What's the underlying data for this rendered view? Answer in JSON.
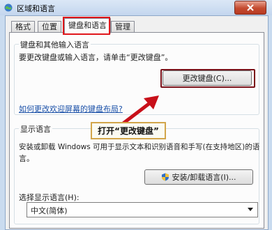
{
  "window": {
    "title": "区域和语言"
  },
  "tabs": [
    {
      "label": "格式"
    },
    {
      "label": "位置"
    },
    {
      "label": "键盘和语言"
    },
    {
      "label": "管理"
    }
  ],
  "keyboard_group": {
    "legend": "键盘和其他输入语言",
    "description": "要更改键盘或输入语言，请单击“更改键盘”。",
    "change_button": "更改键盘(C)...",
    "help_link": "如何更改欢迎屏幕的键盘布局?"
  },
  "callout": {
    "text": "打开“更改键盘”"
  },
  "display_group": {
    "legend": "显示语言",
    "description_line1": "安装或卸载 Windows 可用于显示文本和识别语音和手写(在支持地区)的语",
    "description_line2": "言。",
    "install_button": "安装/卸载语言(I)...",
    "select_label": "选择显示语言(H):",
    "select_value": "中文(简体)"
  },
  "colors": {
    "highlight": "#e0161b",
    "callout_border": "#d2a64b",
    "link": "#1a50a8"
  }
}
